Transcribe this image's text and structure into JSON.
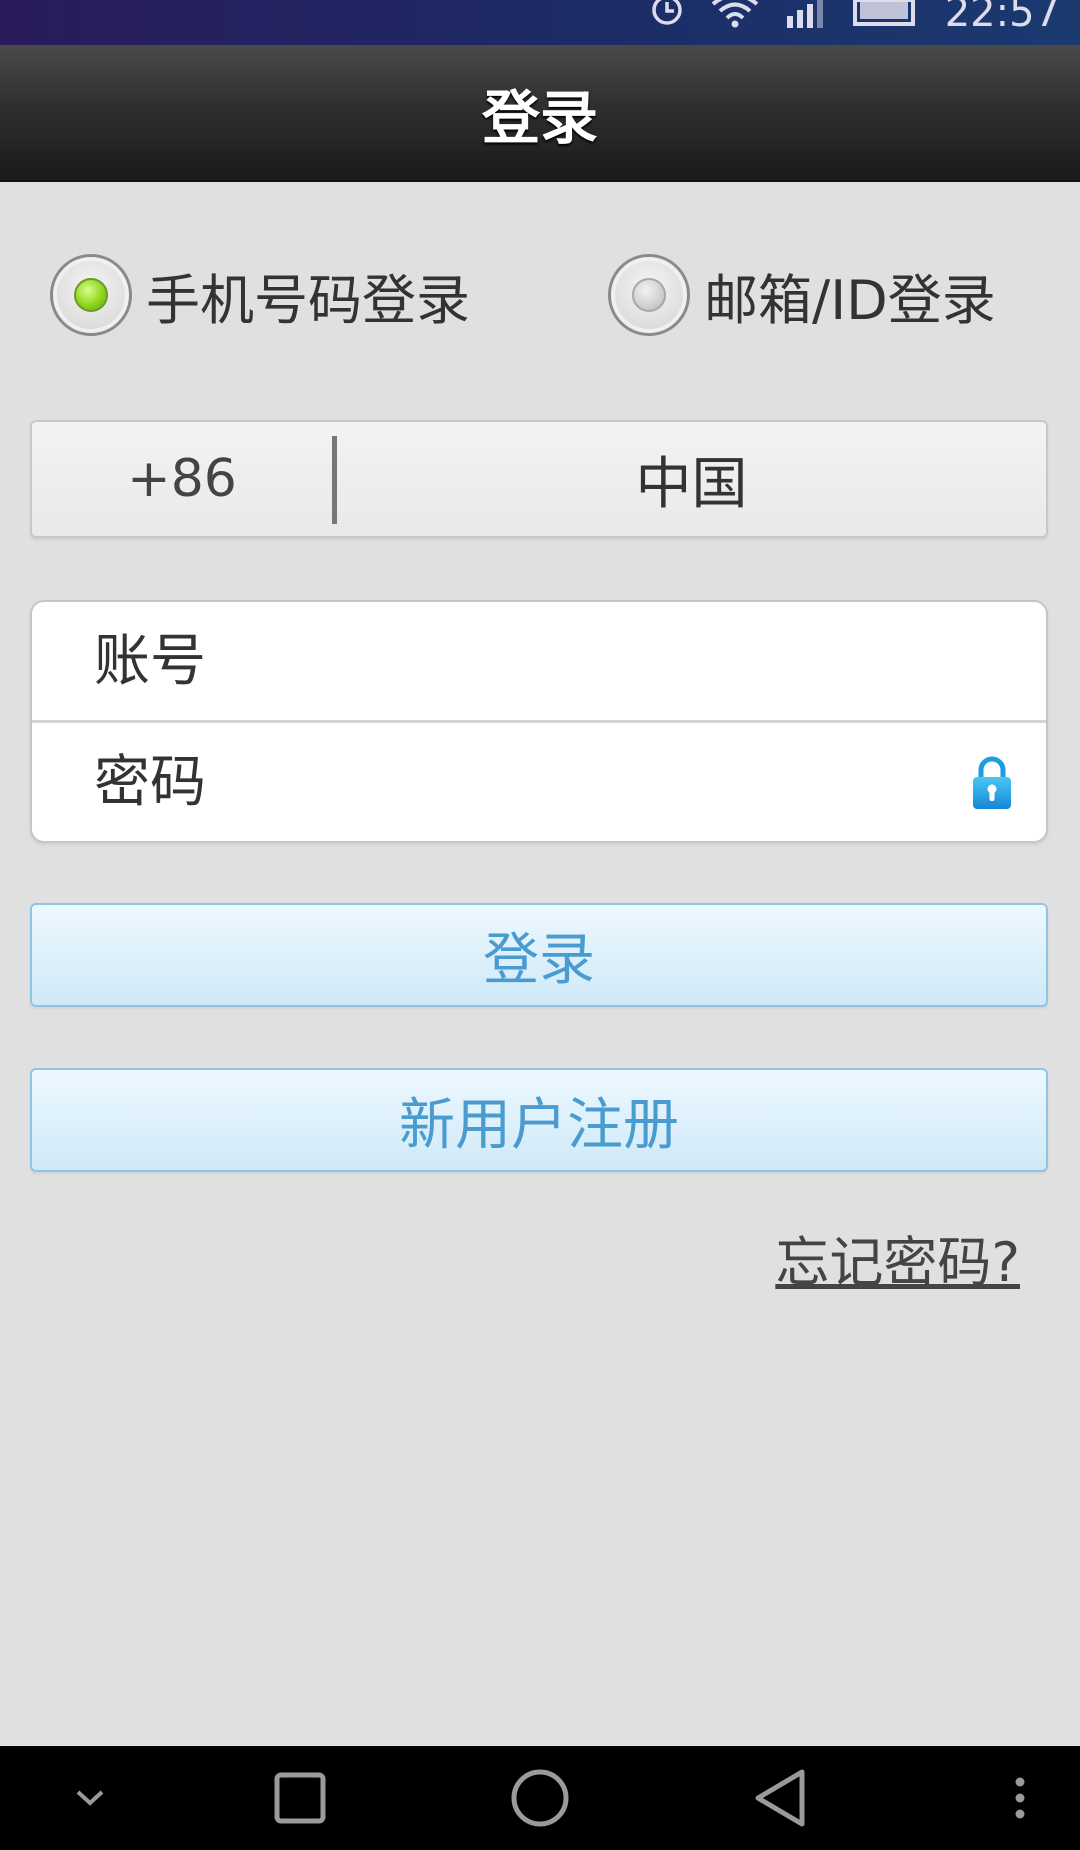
{
  "status_bar": {
    "time": "22:57",
    "icons": [
      "alarm-icon",
      "wifi-icon",
      "signal-icon",
      "battery-icon"
    ]
  },
  "header": {
    "title": "登录"
  },
  "login_mode": {
    "options": [
      {
        "label": "手机号码登录",
        "selected": true
      },
      {
        "label": "邮箱/ID登录",
        "selected": false
      }
    ]
  },
  "country": {
    "code": "+86",
    "name": "中国"
  },
  "form": {
    "account_placeholder": "账号",
    "password_placeholder": "密码",
    "account_value": "",
    "password_value": ""
  },
  "buttons": {
    "login_label": "登录",
    "register_label": "新用户注册"
  },
  "links": {
    "forgot_password": "忘记密码?"
  },
  "colors": {
    "accent_text": "#4a9bd0",
    "radio_selected": "#8fd61e",
    "lock_icon": "#1e9ee0"
  },
  "nav_bar": {
    "icons": [
      "hide-keyboard-icon",
      "recent-apps-icon",
      "home-icon",
      "back-icon",
      "more-icon"
    ]
  }
}
